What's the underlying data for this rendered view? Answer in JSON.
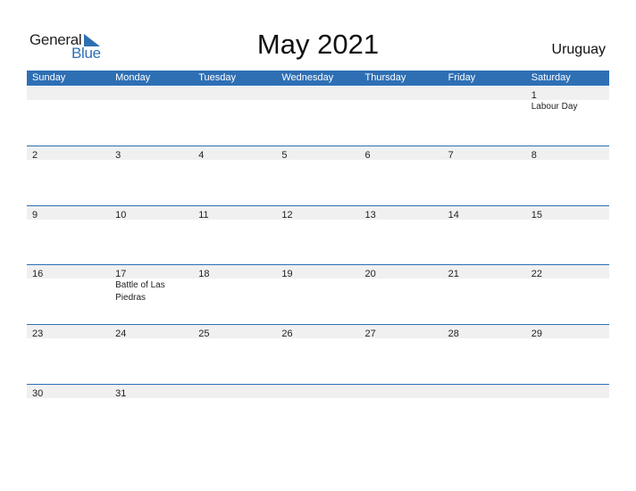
{
  "logo": {
    "word1": "General",
    "word2": "Blue"
  },
  "title": "May 2021",
  "country": "Uruguay",
  "colors": {
    "accent": "#2e6fb4",
    "daybar": "#f0f0f0"
  },
  "weekdays": [
    "Sunday",
    "Monday",
    "Tuesday",
    "Wednesday",
    "Thursday",
    "Friday",
    "Saturday"
  ],
  "weeks": [
    [
      {
        "day": "",
        "event": ""
      },
      {
        "day": "",
        "event": ""
      },
      {
        "day": "",
        "event": ""
      },
      {
        "day": "",
        "event": ""
      },
      {
        "day": "",
        "event": ""
      },
      {
        "day": "",
        "event": ""
      },
      {
        "day": "1",
        "event": "Labour Day"
      }
    ],
    [
      {
        "day": "2",
        "event": ""
      },
      {
        "day": "3",
        "event": ""
      },
      {
        "day": "4",
        "event": ""
      },
      {
        "day": "5",
        "event": ""
      },
      {
        "day": "6",
        "event": ""
      },
      {
        "day": "7",
        "event": ""
      },
      {
        "day": "8",
        "event": ""
      }
    ],
    [
      {
        "day": "9",
        "event": ""
      },
      {
        "day": "10",
        "event": ""
      },
      {
        "day": "11",
        "event": ""
      },
      {
        "day": "12",
        "event": ""
      },
      {
        "day": "13",
        "event": ""
      },
      {
        "day": "14",
        "event": ""
      },
      {
        "day": "15",
        "event": ""
      }
    ],
    [
      {
        "day": "16",
        "event": ""
      },
      {
        "day": "17",
        "event": "Battle of Las Piedras"
      },
      {
        "day": "18",
        "event": ""
      },
      {
        "day": "19",
        "event": ""
      },
      {
        "day": "20",
        "event": ""
      },
      {
        "day": "21",
        "event": ""
      },
      {
        "day": "22",
        "event": ""
      }
    ],
    [
      {
        "day": "23",
        "event": ""
      },
      {
        "day": "24",
        "event": ""
      },
      {
        "day": "25",
        "event": ""
      },
      {
        "day": "26",
        "event": ""
      },
      {
        "day": "27",
        "event": ""
      },
      {
        "day": "28",
        "event": ""
      },
      {
        "day": "29",
        "event": ""
      }
    ],
    [
      {
        "day": "30",
        "event": ""
      },
      {
        "day": "31",
        "event": ""
      },
      {
        "day": "",
        "event": ""
      },
      {
        "day": "",
        "event": ""
      },
      {
        "day": "",
        "event": ""
      },
      {
        "day": "",
        "event": ""
      },
      {
        "day": "",
        "event": ""
      }
    ]
  ]
}
